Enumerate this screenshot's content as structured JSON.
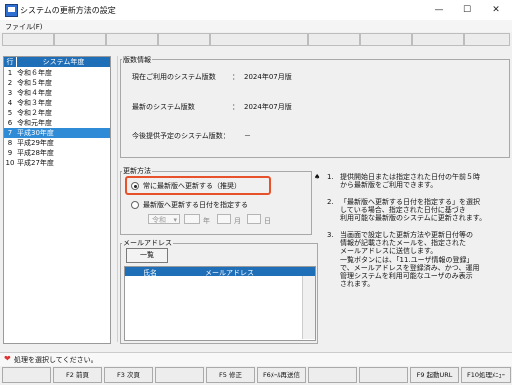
{
  "window": {
    "title": "システムの更新方法の設定",
    "minimize": "—",
    "maximize": "☐",
    "close": "✕",
    "icon": "app-icon"
  },
  "menu": {
    "file": "ファイル(F)"
  },
  "yearlist": {
    "header_num": "行",
    "header_name": "システム年度",
    "rows": [
      {
        "n": "1",
        "t": "令和６年度"
      },
      {
        "n": "2",
        "t": "令和５年度"
      },
      {
        "n": "3",
        "t": "令和４年度"
      },
      {
        "n": "4",
        "t": "令和３年度"
      },
      {
        "n": "5",
        "t": "令和２年度"
      },
      {
        "n": "6",
        "t": "令和元年度"
      },
      {
        "n": "7",
        "t": "平成30年度"
      },
      {
        "n": "8",
        "t": "平成29年度"
      },
      {
        "n": "9",
        "t": "平成28年度"
      },
      {
        "n": "10",
        "t": "平成27年度"
      }
    ],
    "selected_index": 6
  },
  "version_info": {
    "group_label": "版数情報",
    "current_label": "現在ご利用のシステム版数",
    "current_sep": "：",
    "current_value": "2024年07月版",
    "latest_label": "最新のシステム版数",
    "latest_sep": "：",
    "latest_value": "2024年07月版",
    "planned_label": "今後提供予定のシステム版数：",
    "planned_value": "－"
  },
  "update_method": {
    "group_label": "更新方法",
    "option_always": "常に最新版へ更新する（推奨）",
    "option_date": "最新版へ更新する日付を指定する",
    "era_value": "令和",
    "year_unit": "年",
    "month_unit": "月",
    "day_unit": "日"
  },
  "mail": {
    "group_label": "メールアドレス",
    "list_button": "一覧",
    "col_name": "氏名",
    "col_address": "メールアドレス"
  },
  "notes": {
    "bullet": "♠",
    "n1_num": "1.",
    "n1_l1": "提供開始日または指定された日付の午前５時",
    "n1_l2": "から最新版をご利用できます。",
    "n2_num": "2.",
    "n2_l1": "「最新版へ更新する日付を指定する」を選択",
    "n2_l2": "している場合、指定された日付に基づき",
    "n2_l3": "利用可能な最新版のシステムに更新されます。",
    "n3_num": "3.",
    "n3_l1": "当画面で設定した更新方法や更新日付等の",
    "n3_l2": "情報が記載されたメールを、指定された",
    "n3_l3": "メールアドレスに送信します。",
    "n3_l4": "一覧ボタンには、「11.ユーザ情報の登録」",
    "n3_l5": "で、メールアドレスを登録済み、かつ、運用",
    "n3_l6": "管理システムを利用可能なユーザのみ表示",
    "n3_l7": "されます。"
  },
  "status": {
    "text": "処理を選択してください。",
    "icon": "heart-icon"
  },
  "fkeys": [
    "",
    "F2 前頁",
    "F3 次頁",
    "",
    "F5 修正",
    "F6ﾒｰﾙ再送信",
    "",
    "",
    "F9 起動URL",
    "F10処理ﾒﾆｭｰ"
  ],
  "colors": {
    "header_blue": "#1f6fb8",
    "selected_row": "#2f8bd6",
    "highlight": "#e8522a"
  }
}
